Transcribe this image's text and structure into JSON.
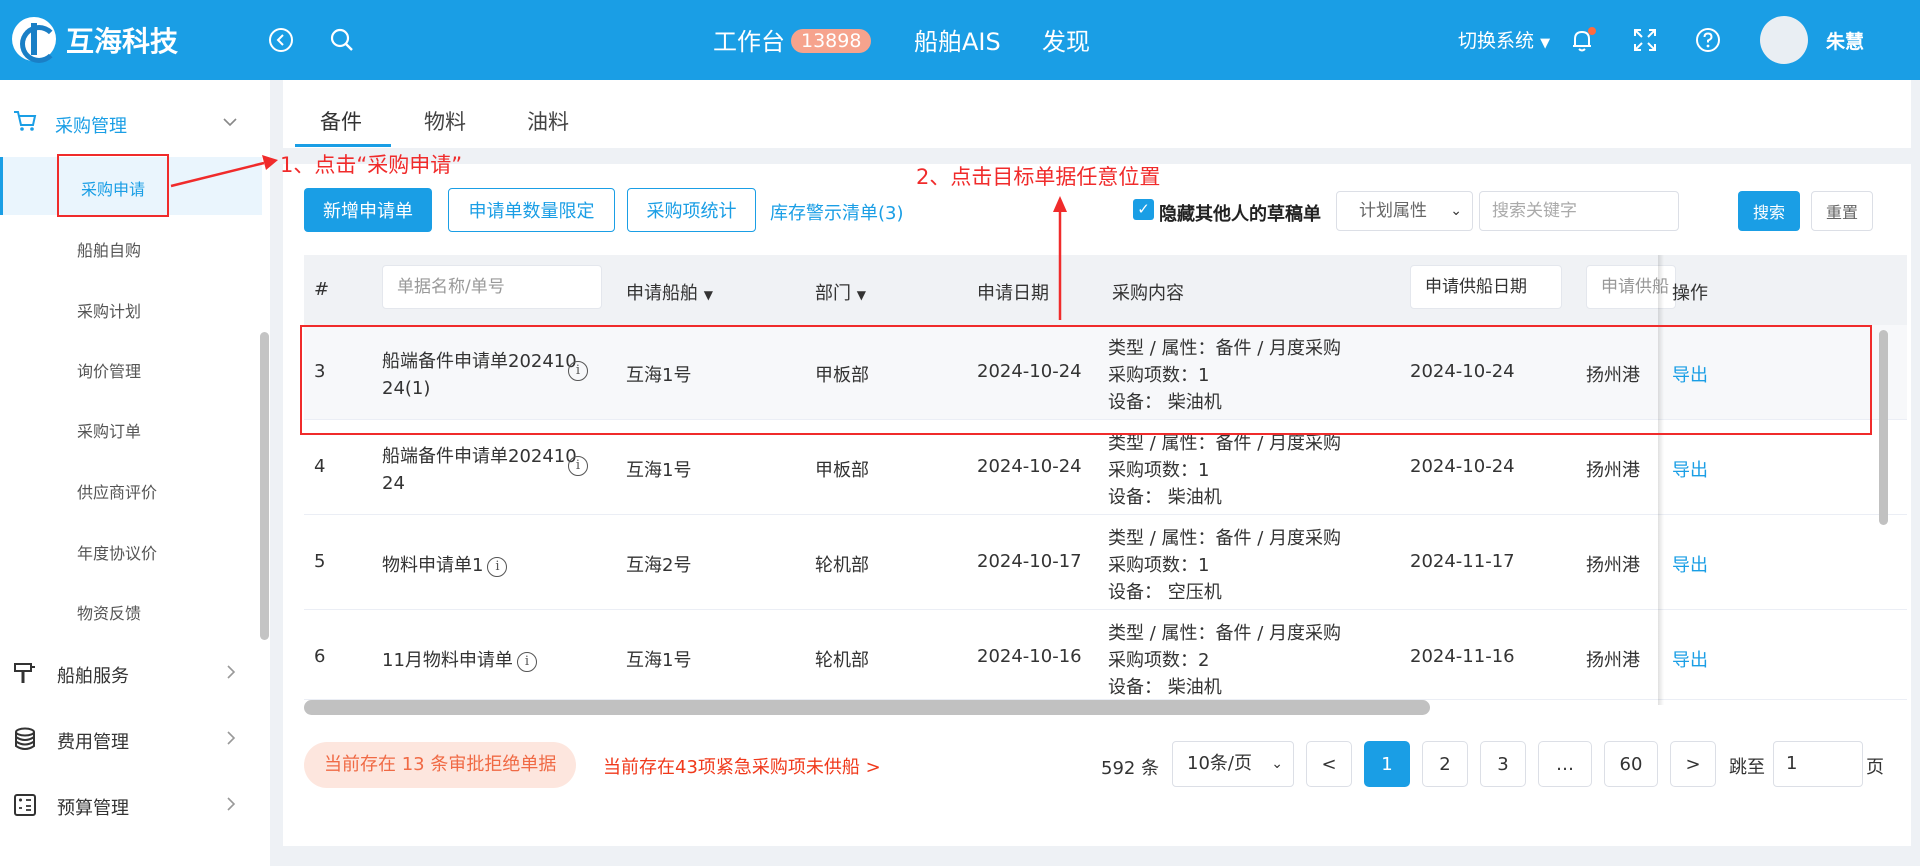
{
  "header": {
    "brand": "互海科技",
    "nav": [
      {
        "label": "工作台",
        "badge": "13898"
      },
      {
        "label": "船舶AIS"
      },
      {
        "label": "发现"
      }
    ],
    "switch_label": "切换系统",
    "user_name": "朱慧"
  },
  "sidebar": {
    "section": "采购管理",
    "items": [
      "采购申请",
      "船舶自购",
      "采购计划",
      "询价管理",
      "采购订单",
      "供应商评价",
      "年度协议价",
      "物资反馈"
    ],
    "active_item": "采购申请",
    "groups": [
      "船舶服务",
      "费用管理",
      "预算管理"
    ]
  },
  "tabs": [
    "备件",
    "物料",
    "油料"
  ],
  "active_tab": "备件",
  "toolbar": {
    "add": "新增申请单",
    "limit": "申请单数量限定",
    "stats": "采购项统计",
    "stock_warn": "库存警示清单(3)",
    "hide_drafts": "隐藏其他人的草稿单",
    "plan_attr": "计划属性",
    "search_placeholder": "搜索关键字",
    "search": "搜索",
    "reset": "重置"
  },
  "table": {
    "headers": {
      "index": "#",
      "name_placeholder": "单据名称/单号",
      "ship": "申请船舶",
      "dept": "部门",
      "date": "申请日期",
      "content": "采购内容",
      "supply_date": "申请供船日期",
      "supply_port": "申请供船",
      "ops": "操作"
    },
    "rows": [
      {
        "idx": "3",
        "name1": "船端备件申请单202410",
        "name2": "24(1)",
        "ship": "互海1号",
        "dept": "甲板部",
        "date": "2024-10-24",
        "c1": "类型 / 属性：备件 / 月度采购",
        "c2": "采购项数：1",
        "c3": "设备：  柴油机",
        "supply_date": "2024-10-24",
        "port": "扬州港",
        "op": "导出"
      },
      {
        "idx": "4",
        "name1": "船端备件申请单202410",
        "name2": "24",
        "ship": "互海1号",
        "dept": "甲板部",
        "date": "2024-10-24",
        "c1": "类型 / 属性：备件 / 月度采购",
        "c2": "采购项数：1",
        "c3": "设备：  柴油机",
        "supply_date": "2024-10-24",
        "port": "扬州港",
        "op": "导出"
      },
      {
        "idx": "5",
        "name1": "物料申请单1",
        "name2": "",
        "ship": "互海2号",
        "dept": "轮机部",
        "date": "2024-10-17",
        "c1": "类型 / 属性：备件 / 月度采购",
        "c2": "采购项数：1",
        "c3": "设备：  空压机",
        "supply_date": "2024-11-17",
        "port": "扬州港",
        "op": "导出"
      },
      {
        "idx": "6",
        "name1": "11月物料申请单",
        "name2": "",
        "ship": "互海1号",
        "dept": "轮机部",
        "date": "2024-10-16",
        "c1": "类型 / 属性：备件 / 月度采购",
        "c2": "采购项数：2",
        "c3": "设备：  柴油机",
        "supply_date": "2024-11-16",
        "port": "扬州港",
        "op": "导出"
      }
    ]
  },
  "footer": {
    "reject_tip": "当前存在 13 条审批拒绝单据",
    "urgent_tip": "当前存在43项紧急采购项未供船  >",
    "total": "592 条",
    "page_size": "10条/页",
    "pages": [
      "1",
      "2",
      "3",
      "…",
      "60"
    ],
    "prev": "<",
    "next": ">",
    "jump_label": "跳至",
    "jump_value": "1",
    "page_unit": "页"
  },
  "annotations": {
    "step1": "1、点击“采购申请”",
    "step2": "2、点击目标单据任意位置"
  },
  "colors": {
    "primary": "#1a9ee5",
    "annotation": "#f02b2b",
    "badge": "#f6a38d"
  }
}
